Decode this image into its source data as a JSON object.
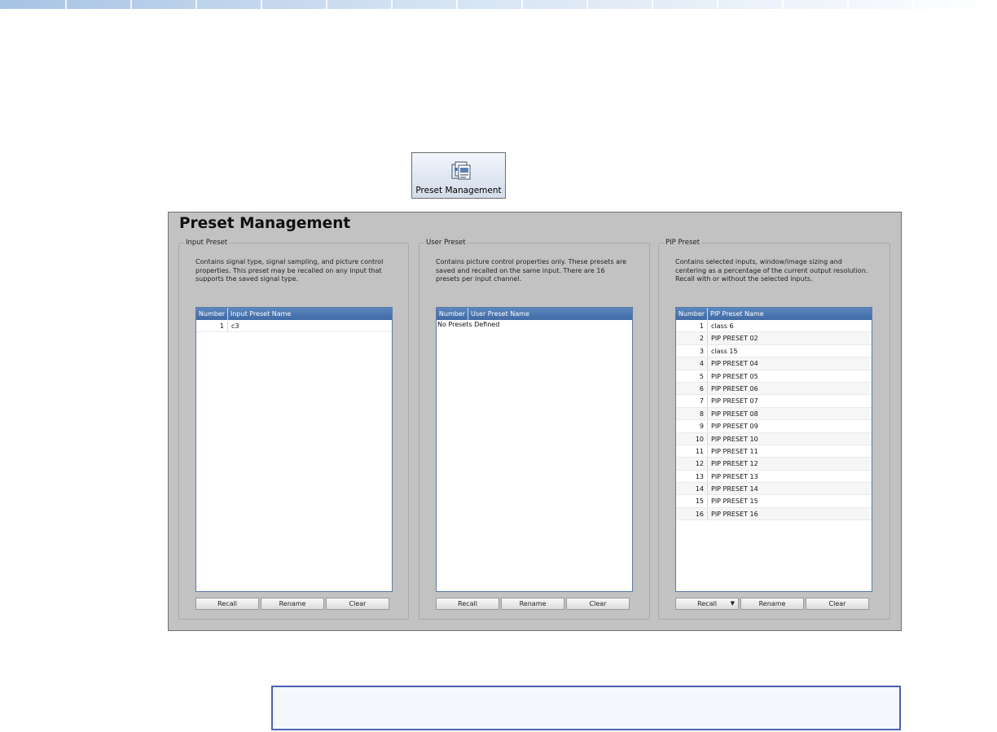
{
  "ribbon": {
    "button_label": "Preset Management",
    "icon": "preset-management-icon"
  },
  "window": {
    "title": "Preset Management"
  },
  "groups": {
    "input": {
      "label": "Input Preset",
      "description": "Contains signal type, signal sampling, and picture control properties. This preset may be recalled on any input that supports the saved signal type.",
      "columns": {
        "number": "Number",
        "name": "Input Preset Name"
      },
      "rows": [
        {
          "number": "1",
          "name": "c3"
        }
      ],
      "buttons": {
        "recall": "Recall",
        "rename": "Rename",
        "clear": "Clear"
      }
    },
    "user": {
      "label": "User Preset",
      "description": "Contains picture control properties only. These presets are saved and recalled on the same input. There are 16 presets per input channel.",
      "columns": {
        "number": "Number",
        "name": "User Preset Name"
      },
      "empty_message": "No Presets Defined",
      "buttons": {
        "recall": "Recall",
        "rename": "Rename",
        "clear": "Clear"
      }
    },
    "pip": {
      "label": "PIP Preset",
      "description": "Contains selected inputs, window/image sizing and centering as a percentage of the current output resolution. Recall with or without the selected inputs.",
      "columns": {
        "number": "Number",
        "name": "PIP Preset Name"
      },
      "rows": [
        {
          "number": "1",
          "name": "class 6"
        },
        {
          "number": "2",
          "name": "PIP PRESET 02"
        },
        {
          "number": "3",
          "name": "class 15"
        },
        {
          "number": "4",
          "name": "PIP PRESET 04"
        },
        {
          "number": "5",
          "name": "PIP PRESET 05"
        },
        {
          "number": "6",
          "name": "PIP PRESET 06"
        },
        {
          "number": "7",
          "name": "PIP PRESET 07"
        },
        {
          "number": "8",
          "name": "PIP PRESET 08"
        },
        {
          "number": "9",
          "name": "PIP PRESET 09"
        },
        {
          "number": "10",
          "name": "PIP PRESET 10"
        },
        {
          "number": "11",
          "name": "PIP PRESET 11"
        },
        {
          "number": "12",
          "name": "PIP PRESET 12"
        },
        {
          "number": "13",
          "name": "PIP PRESET 13"
        },
        {
          "number": "14",
          "name": "PIP PRESET 14"
        },
        {
          "number": "15",
          "name": "PIP PRESET 15"
        },
        {
          "number": "16",
          "name": "PIP PRESET 16"
        }
      ],
      "buttons": {
        "recall": "Recall",
        "recall_dropdown_icon": "dropdown-arrow-icon",
        "rename": "Rename",
        "clear": "Clear"
      }
    }
  },
  "colors": {
    "window_bg": "#c2c2c2",
    "list_header": "#4a76b0",
    "note_border": "#4b62b0"
  }
}
